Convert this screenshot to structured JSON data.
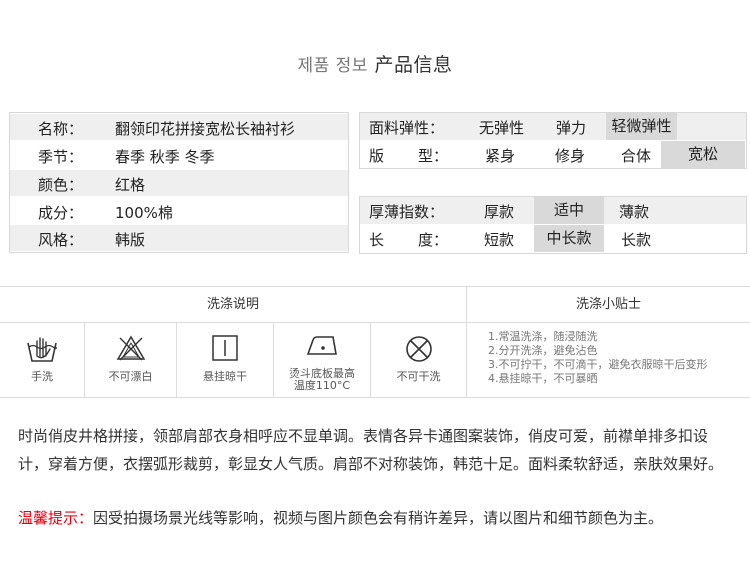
{
  "title": {
    "korean": "제품 정보",
    "chinese": "产品信息"
  },
  "attributes": [
    {
      "key": "名称：",
      "value": "翻领印花拼接宽松长袖衬衫"
    },
    {
      "key": "季节：",
      "value": "春季 秋季 冬季"
    },
    {
      "key": "颜色：",
      "value": "红格"
    },
    {
      "key": "成分：",
      "value": "100%棉"
    },
    {
      "key": "风格：",
      "value": "韩版"
    }
  ],
  "elasticity": {
    "label": "面料弹性：",
    "options": [
      "无弹性",
      "弹力",
      "轻微弹性"
    ],
    "selected": "轻微弹性"
  },
  "fit": {
    "label_a": "版",
    "label_b": "型：",
    "options": [
      "紧身",
      "修身",
      "合体",
      "宽松"
    ],
    "selected": "宽松"
  },
  "thickness": {
    "label": "厚薄指数：",
    "options": [
      "厚款",
      "适中",
      "薄款"
    ],
    "selected": "适中"
  },
  "length": {
    "label_a": "长",
    "label_b": "度：",
    "options": [
      "短款",
      "中长款",
      "长款"
    ],
    "selected": "中长款"
  },
  "wash": {
    "heading": "洗涤说明",
    "items": [
      {
        "icon": "hand-wash-icon",
        "label": "手洗"
      },
      {
        "icon": "no-bleach-icon",
        "label": "不可漂白"
      },
      {
        "icon": "hang-dry-icon",
        "label": "悬挂晾干"
      },
      {
        "icon": "iron-icon",
        "label_line1": "烫斗底板最高",
        "label_line2": "温度110°C"
      },
      {
        "icon": "no-dry-clean-icon",
        "label": "不可干洗"
      }
    ]
  },
  "tips": {
    "heading": "洗涤小贴士",
    "lines": [
      "1.常温洗涤，随浸随洗",
      "2.分开洗涤，避免沾色",
      "3.不可拧干，不可滴干，避免衣服晾干后变形",
      "4.悬挂晾干，不可暴晒"
    ]
  },
  "description": "时尚俏皮井格拼接，领部肩部衣身相呼应不显单调。表情各异卡通图案装饰，俏皮可爱，前襟单排多扣设计，穿着方便，衣摆弧形裁剪，彰显女人气质。肩部不对称装饰，韩范十足。面料柔软舒适，亲肤效果好。",
  "notice": {
    "label": "温馨提示：",
    "text": "因受拍摄场景光线等影响，视频与图片颜色会有稍许差异，请以图片和细节颜色为主。"
  }
}
